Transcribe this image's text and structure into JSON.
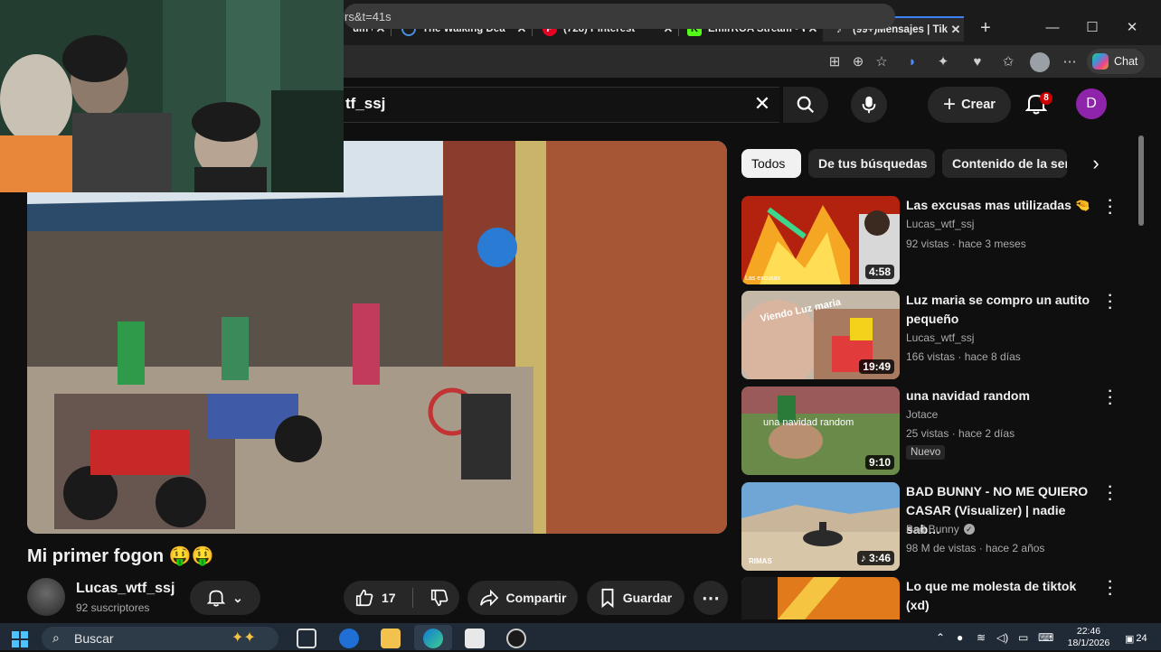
{
  "browser": {
    "tabs": [
      {
        "label": "um d",
        "icon": "generic-icon",
        "active": false
      },
      {
        "label": "The Walking Dea",
        "icon": "globe-icon",
        "active": false
      },
      {
        "label": "(728) Pinterest",
        "icon": "pinterest-icon",
        "active": false
      },
      {
        "label": "EmirROA Stream - W",
        "icon": "kick-icon",
        "active": false
      },
      {
        "label": "(99+)Mensajes | TikTo",
        "icon": "tiktok-icon",
        "active": true
      }
    ],
    "new_tab": "+",
    "address_fragment": "rs&t=41s",
    "chat_label": "Chat"
  },
  "youtube": {
    "search_value": "tf_ssj",
    "create_label": "Crear",
    "notifications": "8",
    "avatar_letter": "D"
  },
  "video": {
    "title": "Mi primer fogon 🤑🤑",
    "channel": "Lucas_wtf_ssj",
    "subscribers": "92 suscriptores",
    "likes": "17",
    "share_label": "Compartir",
    "save_label": "Guardar"
  },
  "chips": [
    "Todos",
    "De tus búsquedas",
    "Contenido de la ser"
  ],
  "recommendations": [
    {
      "title": "Las excusas mas utilizadas 🤏",
      "channel": "Lucas_wtf_ssj",
      "meta": "92 vistas · hace 3 meses",
      "duration": "4:58",
      "thumb_text": "Las excusas"
    },
    {
      "title": "Luz maria se compro un autito pequeño",
      "channel": "Lucas_wtf_ssj",
      "meta": "166 vistas · hace 8 días",
      "duration": "19:49",
      "thumb_text": "Viendo Luz maria"
    },
    {
      "title": "una navidad random",
      "channel": "Jotace",
      "meta": "25 vistas · hace 2 días",
      "duration": "9:10",
      "badge": "Nuevo",
      "thumb_text": "una navidad random"
    },
    {
      "title": "BAD BUNNY - NO ME QUIERO CASAR (Visualizer) | nadie sab…",
      "channel": "Bad Bunny",
      "meta": "98 M de vistas · hace 2 años",
      "duration": "3:46",
      "thumb_text": "RIMAS"
    },
    {
      "title": "Lo que me molesta de tiktok (xd)",
      "channel": "",
      "meta": "",
      "duration": "",
      "thumb_text": ""
    }
  ],
  "taskbar": {
    "search_label": "Buscar",
    "time": "22:46",
    "date": "18/1/2026",
    "notification_count": "24"
  }
}
